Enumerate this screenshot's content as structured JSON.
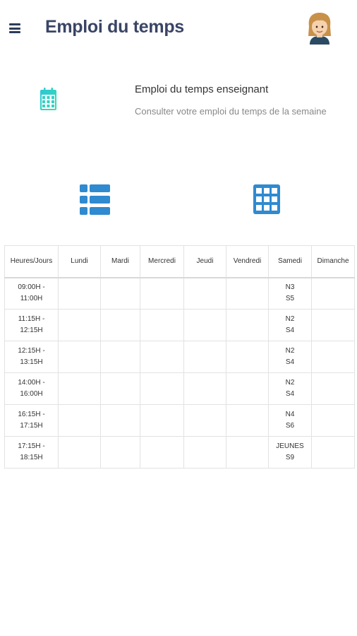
{
  "header": {
    "title": "Emploi du temps",
    "menu_icon": "hamburger-menu-icon",
    "avatar_icon": "user-avatar"
  },
  "intro": {
    "icon": "calendar-icon",
    "title": "Emploi du temps enseignant",
    "subtitle": "Consulter votre emploi du temps de la semaine"
  },
  "views": {
    "list_icon": "list-view-icon",
    "grid_icon": "grid-view-icon"
  },
  "colors": {
    "title": "#3a4565",
    "accent_blue": "#2f8ad0",
    "calendar_teal": "#2ed3c5"
  },
  "table": {
    "headers": [
      "Heures/Jours",
      "Lundi",
      "Mardi",
      "Mercredi",
      "Jeudi",
      "Vendredi",
      "Samedi",
      "Dimanche"
    ],
    "rows": [
      {
        "time": "09:00H -\n11:00H",
        "cells": [
          "",
          "",
          "",
          "",
          "",
          "N3\nS5",
          ""
        ]
      },
      {
        "time": "11:15H - 12:15H",
        "cells": [
          "",
          "",
          "",
          "",
          "",
          "N2\nS4",
          ""
        ]
      },
      {
        "time": "12:15H - 13:15H",
        "cells": [
          "",
          "",
          "",
          "",
          "",
          "N2\nS4",
          ""
        ]
      },
      {
        "time": "14:00H -\n16:00H",
        "cells": [
          "",
          "",
          "",
          "",
          "",
          "N2\nS4",
          ""
        ]
      },
      {
        "time": "16:15H - 17:15H",
        "cells": [
          "",
          "",
          "",
          "",
          "",
          "N4\nS6",
          ""
        ]
      },
      {
        "time": "17:15H - 18:15H",
        "cells": [
          "",
          "",
          "",
          "",
          "",
          "JEUNES\nS9",
          ""
        ]
      }
    ]
  }
}
